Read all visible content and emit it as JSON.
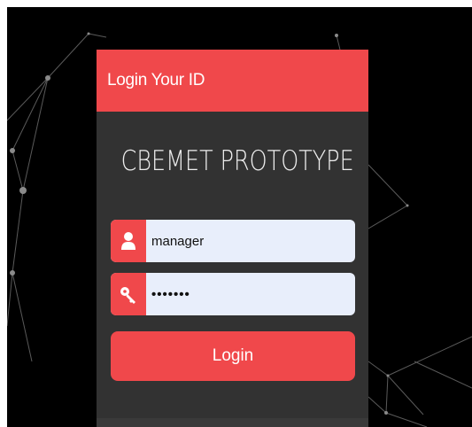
{
  "header": {
    "title": "Login Your ID"
  },
  "brand": {
    "title": "CBEMET PROTOTYPE"
  },
  "form": {
    "username": {
      "value": "manager",
      "icon": "user-icon"
    },
    "password": {
      "value": "•••••••",
      "icon": "key-icon"
    },
    "login_label": "Login"
  },
  "colors": {
    "accent": "#f0484b",
    "panel": "#323232",
    "background": "#000000",
    "field": "#e8eefb"
  }
}
